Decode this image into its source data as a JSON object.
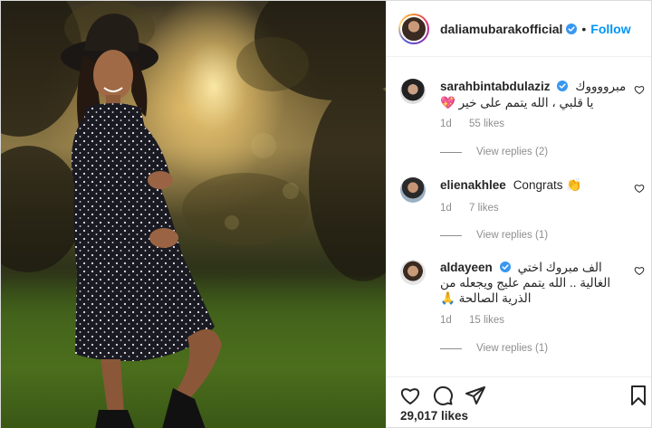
{
  "header": {
    "username": "daliamubarakofficial",
    "separator": "•",
    "follow_label": "Follow"
  },
  "comments": [
    {
      "username": "sarahbintabdulaziz",
      "text_line1": "مبرووووك",
      "text_line2": "يا قلبي ، الله يتمم على خير",
      "emoji": "💖",
      "time": "1d",
      "likes": "55 likes",
      "view_replies": "View replies (2)"
    },
    {
      "username": "elienakhlee",
      "text": "Congrats",
      "emoji": "👏",
      "time": "1d",
      "likes": "7 likes",
      "view_replies": "View replies (1)"
    },
    {
      "username": "aldayeen",
      "text_line1": "الف مبروك اختي",
      "text_line2": "الغالية .. الله يتمم عليج ويجعله من",
      "text_line3": "الذرية الصالحة",
      "emoji": "🙏",
      "time": "1d",
      "likes": "15 likes",
      "view_replies": "View replies (1)"
    }
  ],
  "footer": {
    "likes_count": "29,017 likes"
  },
  "icons": {
    "like": "heart-icon",
    "comment": "comment-bubble-icon",
    "share": "paper-plane-icon",
    "save": "bookmark-icon",
    "verified": "verified-badge-icon"
  },
  "colors": {
    "accent": "#0095f6",
    "verified": "#3897f0",
    "secondary_text": "#8e8e8e"
  }
}
